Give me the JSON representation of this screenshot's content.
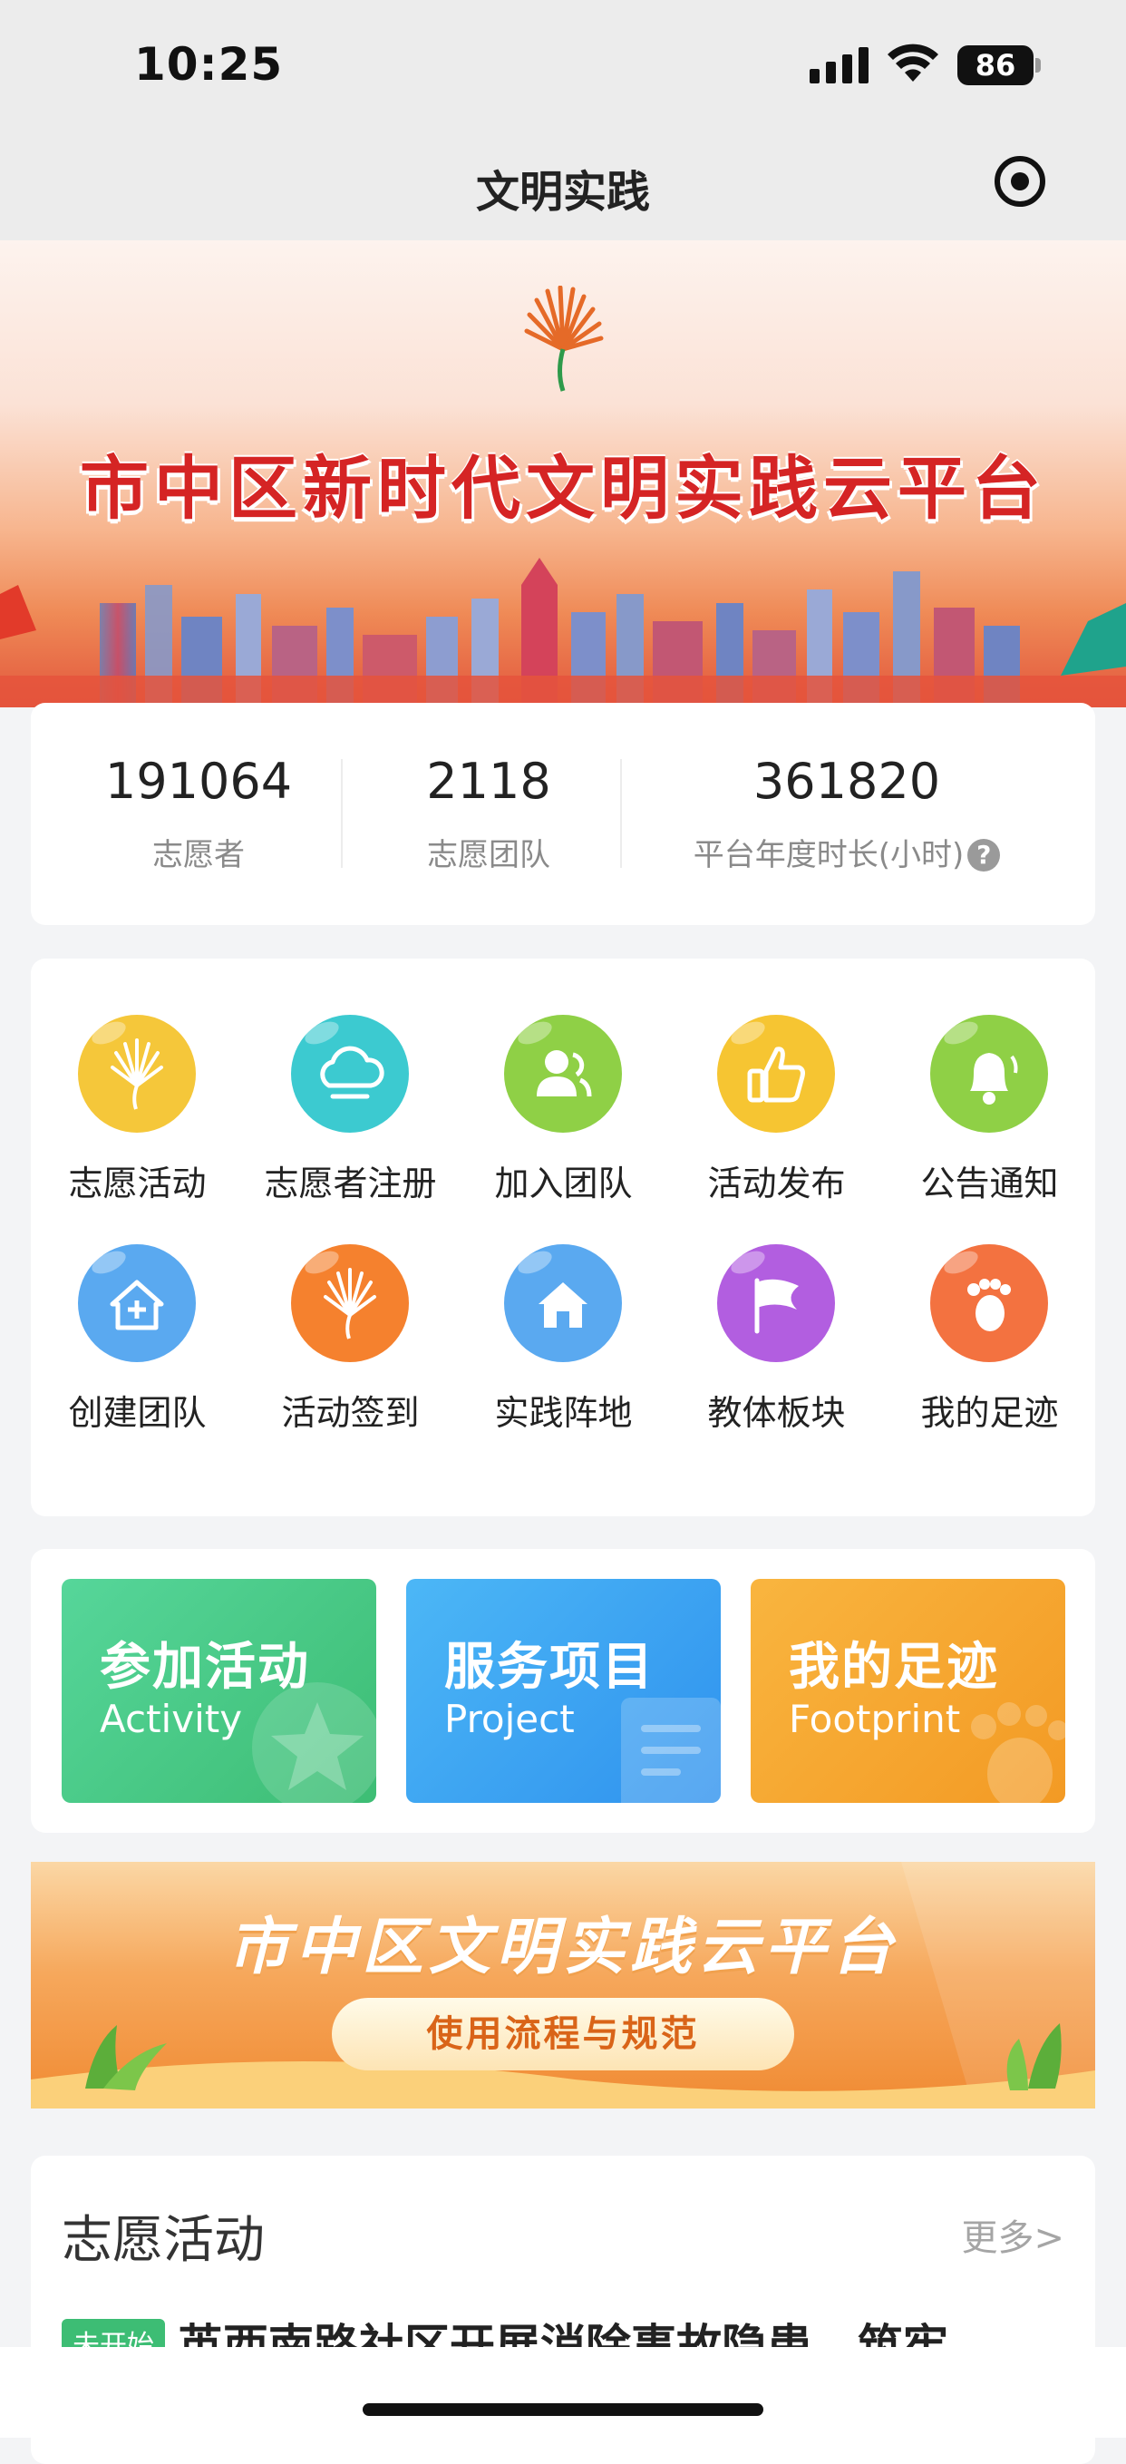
{
  "status_bar": {
    "time": "10:25",
    "battery": "86"
  },
  "nav": {
    "title": "文明实践"
  },
  "banner": {
    "title": "市中区新时代文明实践云平台"
  },
  "stats": [
    {
      "value": "191064",
      "label": "志愿者"
    },
    {
      "value": "2118",
      "label": "志愿团队"
    },
    {
      "value": "361820",
      "label": "平台年度时长(小时)"
    }
  ],
  "grid": [
    {
      "label": "志愿活动",
      "icon": "fan-icon",
      "color": "#f5c73a"
    },
    {
      "label": "志愿者注册",
      "icon": "cloud-icon",
      "color": "#3ccad0"
    },
    {
      "label": "加入团队",
      "icon": "team-icon",
      "color": "#8fd046"
    },
    {
      "label": "活动发布",
      "icon": "thumbs-up-icon",
      "color": "#f6c532"
    },
    {
      "label": "公告通知",
      "icon": "bell-icon",
      "color": "#8fd046"
    },
    {
      "label": "创建团队",
      "icon": "house-plus-icon",
      "color": "#5aa9f0"
    },
    {
      "label": "活动签到",
      "icon": "fan-icon",
      "color": "#f5812e"
    },
    {
      "label": "实践阵地",
      "icon": "house-icon",
      "color": "#5aa9f0"
    },
    {
      "label": "教体板块",
      "icon": "flag-icon",
      "color": "#b25ee0"
    },
    {
      "label": "我的足迹",
      "icon": "footprint-icon",
      "color": "#f37240"
    }
  ],
  "quick_cards": [
    {
      "title": "参加活动",
      "subtitle": "Activity",
      "color": "#48c982"
    },
    {
      "title": "服务项目",
      "subtitle": "Project",
      "color": "#3aa3f2"
    },
    {
      "title": "我的足迹",
      "subtitle": "Footprint",
      "color": "#f5a72e"
    }
  ],
  "promo": {
    "title": "市中区文明实践云平台",
    "button": "使用流程与规范"
  },
  "activity_section": {
    "title": "志愿活动",
    "more": "更多>",
    "first_item": {
      "badge": "未开始",
      "text": "英西南路社区开展消除事故隐患，筑牢"
    }
  }
}
